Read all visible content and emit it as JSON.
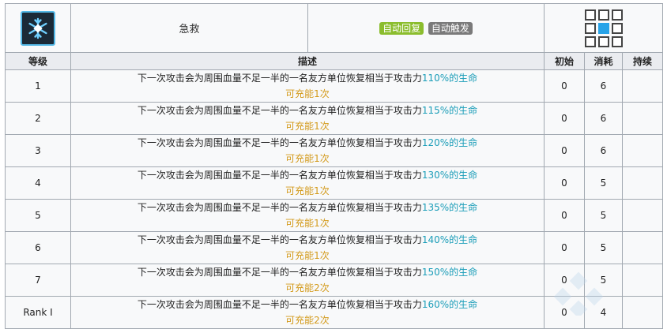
{
  "skill": {
    "name": "急救",
    "icon": "snowflake-cross-icon",
    "tags": [
      {
        "label": "自动回复",
        "color": "#8bbd2d"
      },
      {
        "label": "自动触发",
        "color": "#7a7a7a"
      }
    ]
  },
  "table": {
    "headers": {
      "level": "等级",
      "description": "描述",
      "initial": "初始",
      "cost": "消耗",
      "duration": "持续"
    },
    "rows": [
      {
        "level": "1",
        "prefix": "下一次攻击会为周围血量不足一半的一名友方单位恢复相当于攻击力",
        "highlight": "110%的生命",
        "charge": "可充能1次",
        "initial": "0",
        "cost": "6",
        "duration": ""
      },
      {
        "level": "2",
        "prefix": "下一次攻击会为周围血量不足一半的一名友方单位恢复相当于攻击力",
        "highlight": "115%的生命",
        "charge": "可充能1次",
        "initial": "0",
        "cost": "6",
        "duration": ""
      },
      {
        "level": "3",
        "prefix": "下一次攻击会为周围血量不足一半的一名友方单位恢复相当于攻击力",
        "highlight": "120%的生命",
        "charge": "可充能1次",
        "initial": "0",
        "cost": "6",
        "duration": ""
      },
      {
        "level": "4",
        "prefix": "下一次攻击会为周围血量不足一半的一名友方单位恢复相当于攻击力",
        "highlight": "130%的生命",
        "charge": "可充能1次",
        "initial": "0",
        "cost": "5",
        "duration": ""
      },
      {
        "level": "5",
        "prefix": "下一次攻击会为周围血量不足一半的一名友方单位恢复相当于攻击力",
        "highlight": "135%的生命",
        "charge": "可充能1次",
        "initial": "0",
        "cost": "5",
        "duration": ""
      },
      {
        "level": "6",
        "prefix": "下一次攻击会为周围血量不足一半的一名友方单位恢复相当于攻击力",
        "highlight": "140%的生命",
        "charge": "可充能1次",
        "initial": "0",
        "cost": "5",
        "duration": ""
      },
      {
        "level": "7",
        "prefix": "下一次攻击会为周围血量不足一半的一名友方单位恢复相当于攻击力",
        "highlight": "150%的生命",
        "charge": "可充能2次",
        "initial": "0",
        "cost": "5",
        "duration": ""
      },
      {
        "level": "Rank Ⅰ",
        "prefix": "下一次攻击会为周围血量不足一半的一名友方单位恢复相当于攻击力",
        "highlight": "160%的生命",
        "charge": "可充能2次",
        "initial": "0",
        "cost": "4",
        "duration": ""
      }
    ]
  },
  "range": {
    "grid": [
      [
        0,
        0,
        0
      ],
      [
        0,
        1,
        0
      ],
      [
        0,
        0,
        0
      ]
    ],
    "self_color": "#27a3e8"
  }
}
